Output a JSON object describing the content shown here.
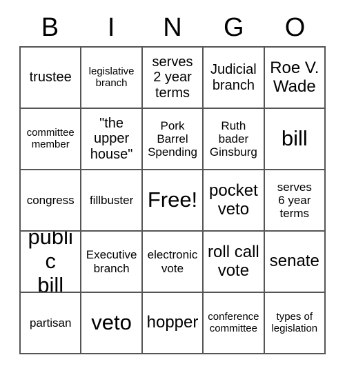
{
  "header": {
    "letters": [
      "B",
      "I",
      "N",
      "G",
      "O"
    ]
  },
  "grid": {
    "columns": 5,
    "rows": 5,
    "border_color": "#555555",
    "background_color": "#ffffff",
    "text_color": "#000000",
    "cells": [
      {
        "text": "trustee",
        "size": "lg"
      },
      {
        "text": "legislative\nbranch",
        "size": "sm"
      },
      {
        "text": "serves\n2 year\nterms",
        "size": "lg"
      },
      {
        "text": "Judicial\nbranch",
        "size": "lg"
      },
      {
        "text": "Roe V.\nWade",
        "size": "xl"
      },
      {
        "text": "committee\nmember",
        "size": "sm"
      },
      {
        "text": "\"the\nupper\nhouse\"",
        "size": "lg"
      },
      {
        "text": "Pork\nBarrel\nSpending",
        "size": "md"
      },
      {
        "text": "Ruth\nbader\nGinsburg",
        "size": "md"
      },
      {
        "text": "bill",
        "size": "xxl"
      },
      {
        "text": "congress",
        "size": "md"
      },
      {
        "text": "fillbuster",
        "size": "md"
      },
      {
        "text": "Free!",
        "size": "xxl"
      },
      {
        "text": "pocket\nveto",
        "size": "xl"
      },
      {
        "text": "serves\n6 year\nterms",
        "size": "md"
      },
      {
        "text": "public\nbill",
        "size": "xxl"
      },
      {
        "text": "Executive\nbranch",
        "size": "md"
      },
      {
        "text": "electronic\nvote",
        "size": "md"
      },
      {
        "text": "roll call\nvote",
        "size": "xl"
      },
      {
        "text": "senate",
        "size": "xl"
      },
      {
        "text": "partisan",
        "size": "md"
      },
      {
        "text": "veto",
        "size": "xxl"
      },
      {
        "text": "hopper",
        "size": "xl"
      },
      {
        "text": "conference\ncommittee",
        "size": "sm"
      },
      {
        "text": "types of\nlegislation",
        "size": "sm"
      }
    ]
  }
}
